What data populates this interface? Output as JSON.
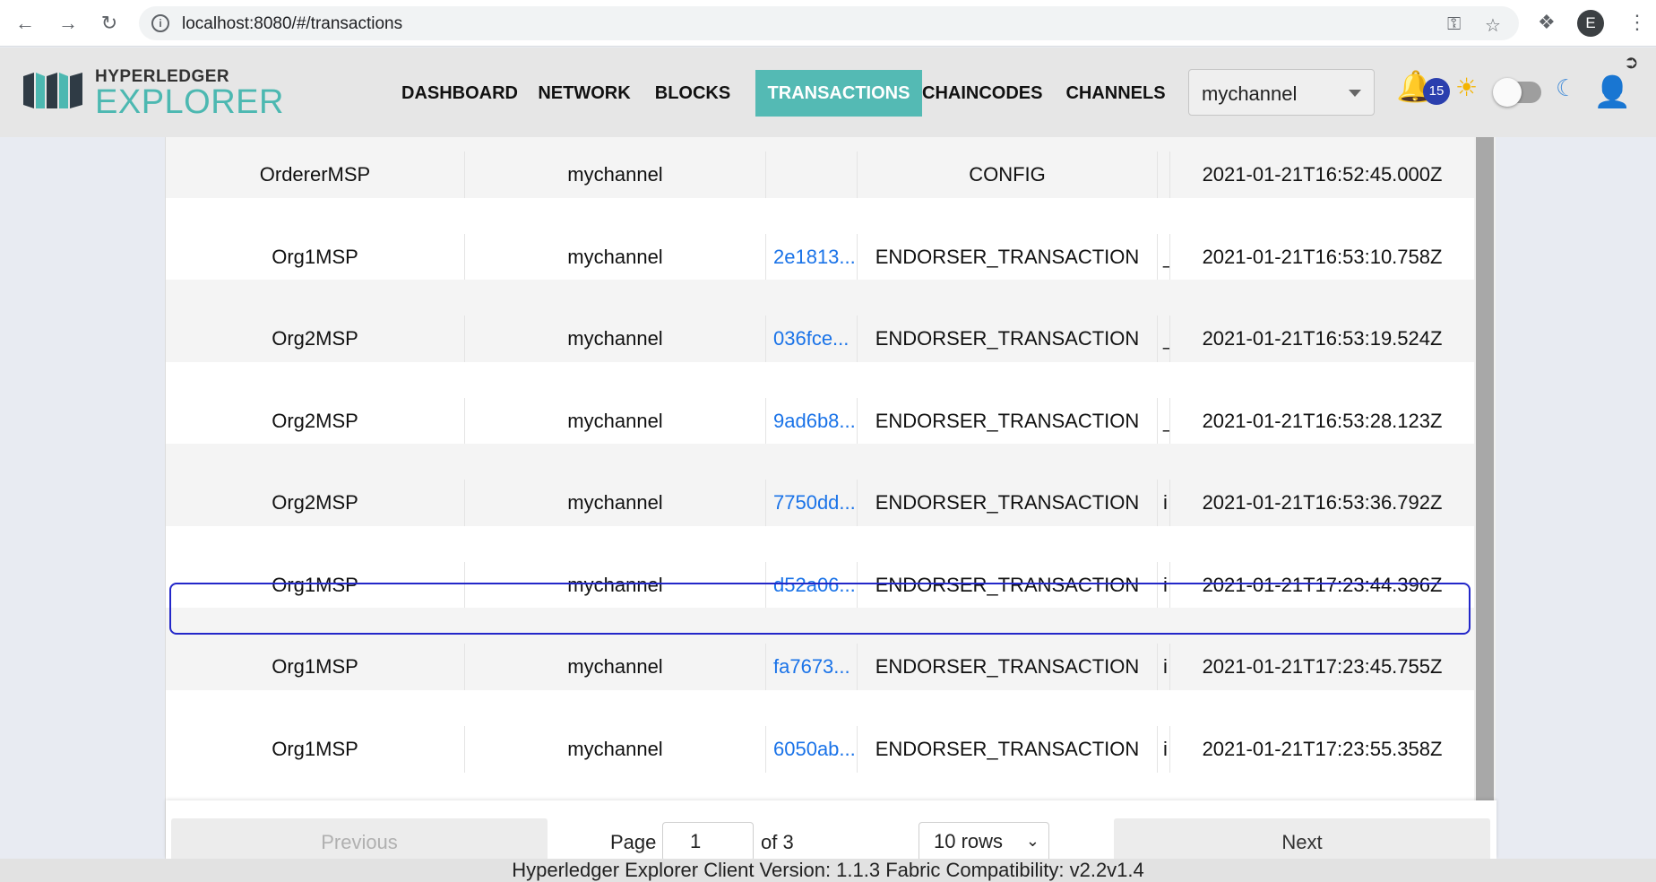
{
  "browser": {
    "url": "localhost:8080/#/transactions",
    "profile_initial": "E"
  },
  "logo": {
    "top_text": "HYPERLEDGER",
    "bottom_text": "EXPLORER"
  },
  "nav": {
    "items": [
      {
        "label": "DASHBOARD"
      },
      {
        "label": "NETWORK"
      },
      {
        "label": "BLOCKS"
      },
      {
        "label": "TRANSACTIONS",
        "active": true
      },
      {
        "label": "CHAINCODES"
      },
      {
        "label": "CHANNELS"
      }
    ],
    "channel_selected": "mychannel",
    "notification_count": "15"
  },
  "table": {
    "rows": [
      {
        "creator": "OrdererMSP",
        "channel": "mychannel",
        "tx_id": "",
        "type": "CONFIG",
        "chaincode": "",
        "timestamp": "2021-01-21T16:52:45.000Z"
      },
      {
        "creator": "Org1MSP",
        "channel": "mychannel",
        "tx_id": "2e1813...",
        "type": "ENDORSER_TRANSACTION",
        "chaincode": "_",
        "timestamp": "2021-01-21T16:53:10.758Z"
      },
      {
        "creator": "Org2MSP",
        "channel": "mychannel",
        "tx_id": "036fce...",
        "type": "ENDORSER_TRANSACTION",
        "chaincode": "_",
        "timestamp": "2021-01-21T16:53:19.524Z"
      },
      {
        "creator": "Org2MSP",
        "channel": "mychannel",
        "tx_id": "9ad6b8...",
        "type": "ENDORSER_TRANSACTION",
        "chaincode": "_",
        "timestamp": "2021-01-21T16:53:28.123Z"
      },
      {
        "creator": "Org2MSP",
        "channel": "mychannel",
        "tx_id": "7750dd...",
        "type": "ENDORSER_TRANSACTION",
        "chaincode": "i",
        "timestamp": "2021-01-21T16:53:36.792Z"
      },
      {
        "creator": "Org1MSP",
        "channel": "mychannel",
        "tx_id": "d52a06...",
        "type": "ENDORSER_TRANSACTION",
        "chaincode": "i",
        "timestamp": "2021-01-21T17:23:44.396Z",
        "selected": true
      },
      {
        "creator": "Org1MSP",
        "channel": "mychannel",
        "tx_id": "fa7673...",
        "type": "ENDORSER_TRANSACTION",
        "chaincode": "i",
        "timestamp": "2021-01-21T17:23:45.755Z"
      },
      {
        "creator": "Org1MSP",
        "channel": "mychannel",
        "tx_id": "6050ab...",
        "type": "ENDORSER_TRANSACTION",
        "chaincode": "i",
        "timestamp": "2021-01-21T17:23:55.358Z"
      }
    ]
  },
  "pagination": {
    "previous_label": "Previous",
    "next_label": "Next",
    "page_label": "Page",
    "page_value": "1",
    "of_label": "of 3",
    "rows_selected": "10 rows"
  },
  "footer": {
    "text": "Hyperledger Explorer Client Version: 1.1.3   Fabric Compatibility: v2.2v1.4"
  },
  "colors": {
    "accent": "#54bab4",
    "link": "#1a73e8",
    "selection_outline": "#2327c9",
    "badge": "#2b3fae"
  }
}
